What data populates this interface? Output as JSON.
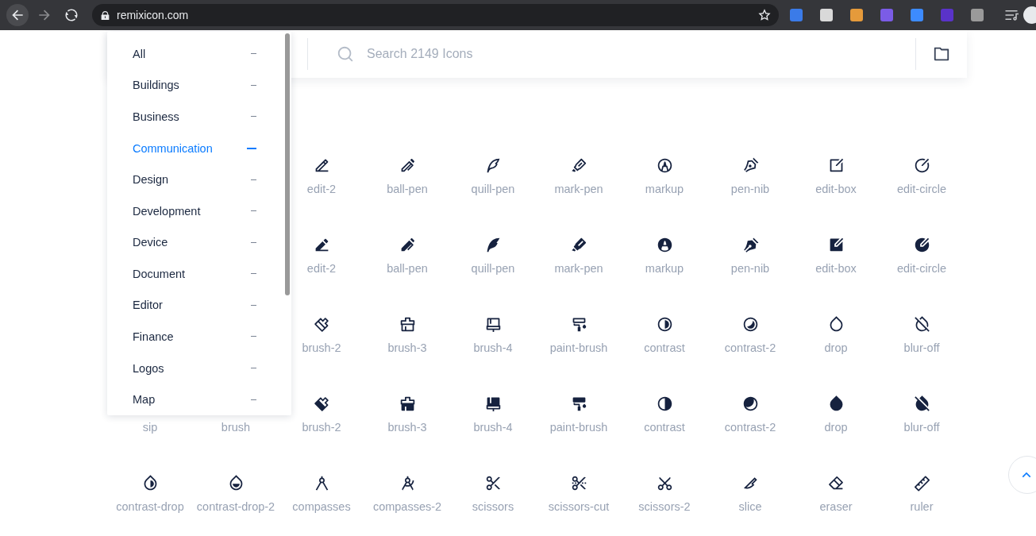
{
  "browser": {
    "url": "remixicon.com"
  },
  "search": {
    "placeholder": "Search 2149 Icons"
  },
  "categories": [
    {
      "label": "All",
      "selected": false
    },
    {
      "label": "Buildings",
      "selected": false
    },
    {
      "label": "Business",
      "selected": false
    },
    {
      "label": "Communication",
      "selected": true
    },
    {
      "label": "Design",
      "selected": false
    },
    {
      "label": "Development",
      "selected": false
    },
    {
      "label": "Device",
      "selected": false
    },
    {
      "label": "Document",
      "selected": false
    },
    {
      "label": "Editor",
      "selected": false
    },
    {
      "label": "Finance",
      "selected": false
    },
    {
      "label": "Logos",
      "selected": false
    },
    {
      "label": "Map",
      "selected": false
    }
  ],
  "rows": [
    {
      "cells": [
        {},
        {},
        {
          "kind": "edit-2-line",
          "label": "edit-2"
        },
        {
          "kind": "ball-pen-line",
          "label": "ball-pen"
        },
        {
          "kind": "quill-pen-line",
          "label": "quill-pen"
        },
        {
          "kind": "mark-pen-line",
          "label": "mark-pen"
        },
        {
          "kind": "markup-line",
          "label": "markup"
        },
        {
          "kind": "pen-nib-line",
          "label": "pen-nib"
        },
        {
          "kind": "edit-box-line",
          "label": "edit-box"
        },
        {
          "kind": "edit-circle-line",
          "label": "edit-circle"
        }
      ]
    },
    {
      "cells": [
        {},
        {},
        {
          "kind": "edit-2-fill",
          "label": "edit-2"
        },
        {
          "kind": "ball-pen-fill",
          "label": "ball-pen"
        },
        {
          "kind": "quill-pen-fill",
          "label": "quill-pen"
        },
        {
          "kind": "mark-pen-fill",
          "label": "mark-pen"
        },
        {
          "kind": "markup-fill",
          "label": "markup"
        },
        {
          "kind": "pen-nib-fill",
          "label": "pen-nib"
        },
        {
          "kind": "edit-box-fill",
          "label": "edit-box"
        },
        {
          "kind": "edit-circle-fill",
          "label": "edit-circle"
        }
      ]
    },
    {
      "cells": [
        {},
        {},
        {
          "kind": "brush-2-line",
          "label": "brush-2"
        },
        {
          "kind": "brush-3-line",
          "label": "brush-3"
        },
        {
          "kind": "brush-4-line",
          "label": "brush-4"
        },
        {
          "kind": "paint-brush-line",
          "label": "paint-brush"
        },
        {
          "kind": "contrast-line",
          "label": "contrast"
        },
        {
          "kind": "contrast-2-line",
          "label": "contrast-2"
        },
        {
          "kind": "drop-line",
          "label": "drop"
        },
        {
          "kind": "blur-off-line",
          "label": "blur-off"
        }
      ]
    },
    {
      "cells": [
        {
          "label": "sip"
        },
        {
          "label": "brush"
        },
        {
          "kind": "brush-2-fill",
          "label": "brush-2"
        },
        {
          "kind": "brush-3-fill",
          "label": "brush-3"
        },
        {
          "kind": "brush-4-fill",
          "label": "brush-4"
        },
        {
          "kind": "paint-brush-fill",
          "label": "paint-brush"
        },
        {
          "kind": "contrast-fill",
          "label": "contrast"
        },
        {
          "kind": "contrast-2-fill",
          "label": "contrast-2"
        },
        {
          "kind": "drop-fill",
          "label": "drop"
        },
        {
          "kind": "blur-off-fill",
          "label": "blur-off"
        }
      ]
    },
    {
      "cells": [
        {
          "kind": "contrast-drop-line",
          "label": "contrast-drop"
        },
        {
          "kind": "contrast-drop-2-line",
          "label": "contrast-drop-2"
        },
        {
          "kind": "compasses-line",
          "label": "compasses"
        },
        {
          "kind": "compasses-2-line",
          "label": "compasses-2"
        },
        {
          "kind": "scissors-line",
          "label": "scissors"
        },
        {
          "kind": "scissors-cut-line",
          "label": "scissors-cut"
        },
        {
          "kind": "scissors-2-line",
          "label": "scissors-2"
        },
        {
          "kind": "slice-line",
          "label": "slice"
        },
        {
          "kind": "eraser-line",
          "label": "eraser"
        },
        {
          "kind": "ruler-line",
          "label": "ruler"
        }
      ]
    }
  ]
}
